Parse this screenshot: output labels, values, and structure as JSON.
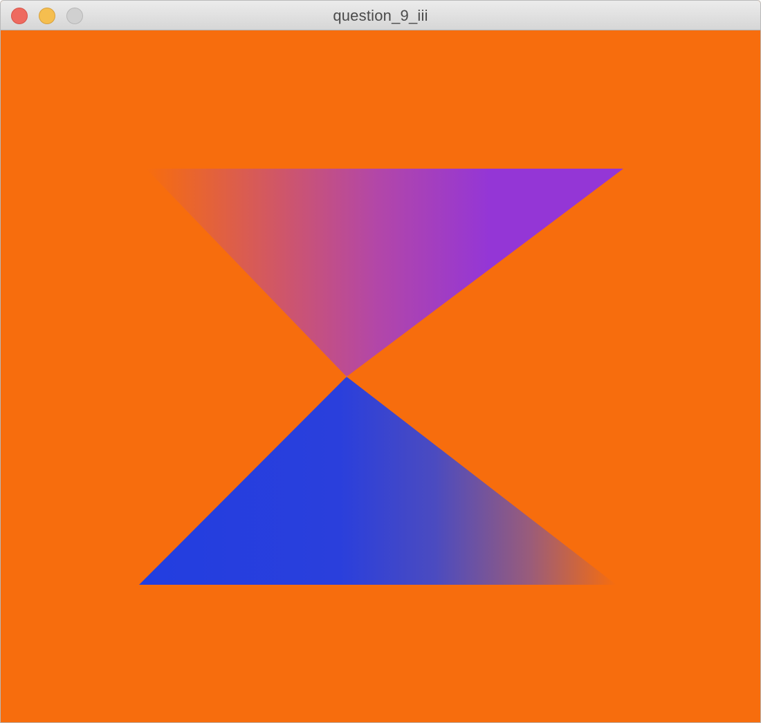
{
  "window": {
    "title": "question_9_iii"
  },
  "colors": {
    "background": "#f76d0d",
    "upper_triangle": "#9436d6",
    "lower_triangle": "#223ee0",
    "titlebar_text": "#4a4a4a",
    "close_button": "#ee6a5f",
    "minimize_button": "#f5be4f",
    "zoom_button": "#d0d0d0"
  },
  "icons": {
    "close": "close-button-icon",
    "minimize": "minimize-button-icon",
    "zoom": "zoom-button-icon"
  }
}
